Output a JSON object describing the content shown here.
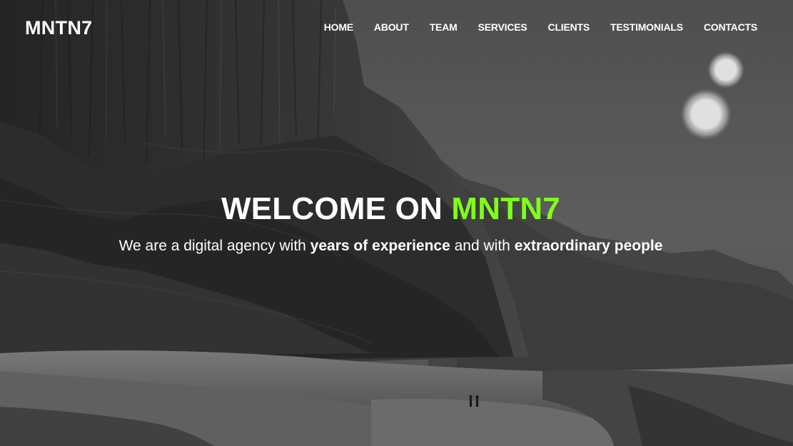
{
  "brand": {
    "logo_text": "MNTN7"
  },
  "nav": {
    "items": [
      {
        "label": "HOME"
      },
      {
        "label": "ABOUT"
      },
      {
        "label": "TEAM"
      },
      {
        "label": "SERVICES"
      },
      {
        "label": "CLIENTS"
      },
      {
        "label": "TESTIMONIALS"
      },
      {
        "label": "CONTACTS"
      }
    ]
  },
  "hero": {
    "title_prefix": "WELCOME ON ",
    "title_highlight": "MNTN7",
    "subtitle_part1": "We are a digital agency with ",
    "subtitle_bold1": "years of experience",
    "subtitle_part2": " and with ",
    "subtitle_bold2": "extraordinary people"
  },
  "colors": {
    "accent": "#7fff1a",
    "text": "#ffffff",
    "background": "#3a3a3a"
  }
}
